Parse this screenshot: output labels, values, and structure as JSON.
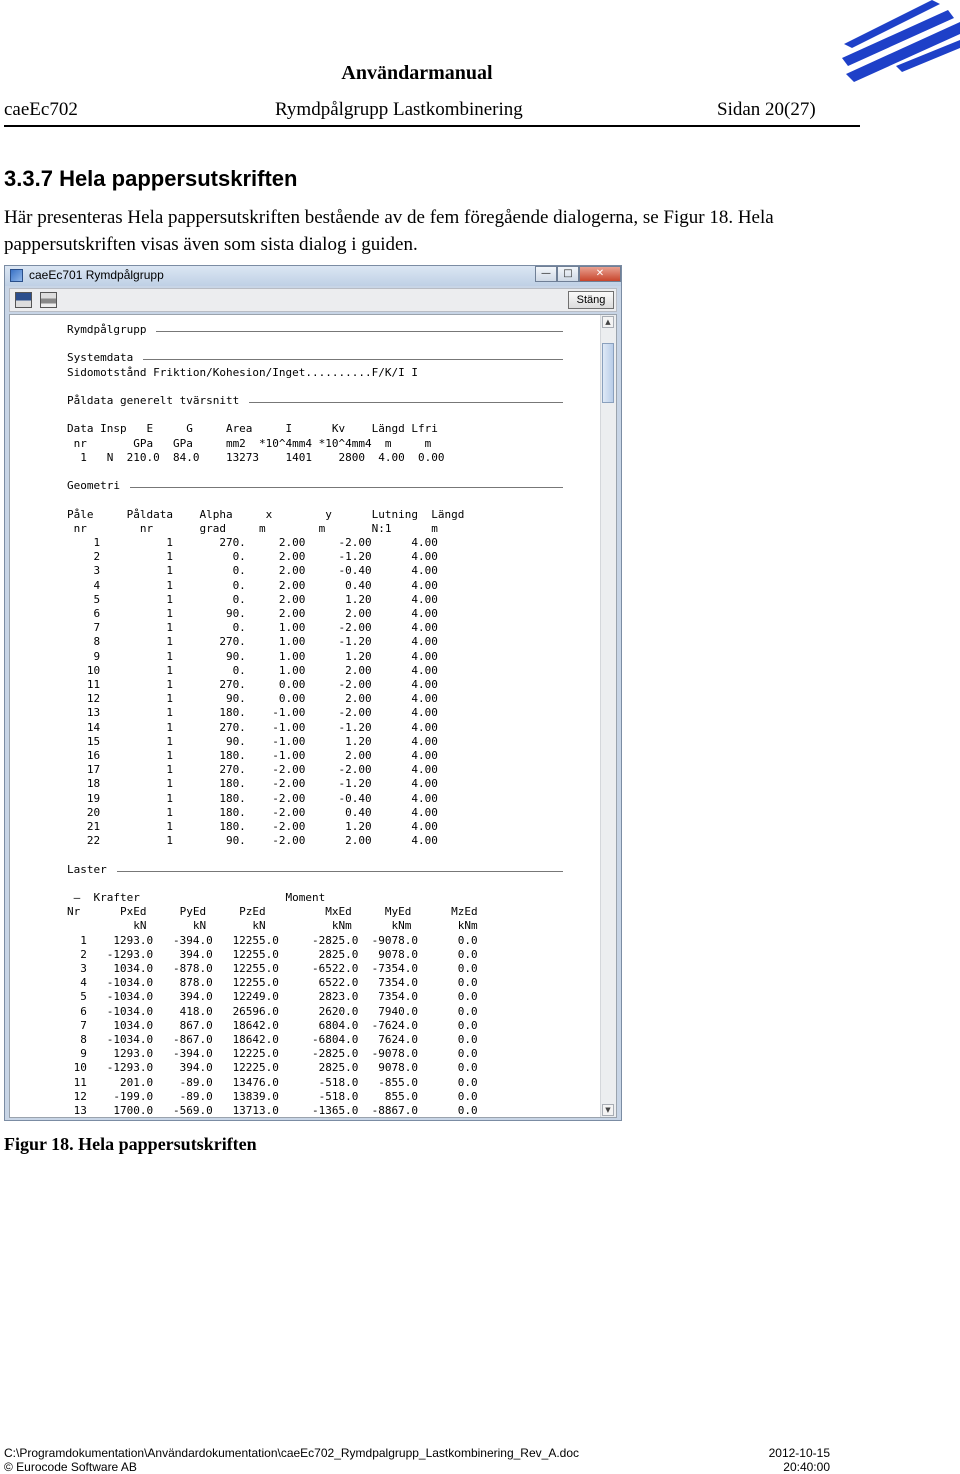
{
  "header": {
    "manual_title": "Användarmanual",
    "product": "caeEc702",
    "module": "Rymdpålgrupp Lastkombinering",
    "page": "Sidan 20(27)"
  },
  "section": {
    "number": "3.3.7",
    "title": "Hela pappersutskriften",
    "paragraph": "Här presenteras Hela pappersutskriften bestående av de fem föregående dialogerna, se Figur 18. Hela pappersutskriften visas även som sista dialog i guiden."
  },
  "window": {
    "title": "caeEc701 Rymdpålgrupp",
    "close_button": "Stäng",
    "report": {
      "heading": "Rymdpålgrupp",
      "systemdata_title": "Systemdata",
      "systemdata_line": "Sidomotstånd Friktion/Kohesion/Inget..........F/K/I I",
      "paldata_title": "Påldata generelt tvärsnitt",
      "paldata_header1": "Data Insp   E     G     Area     I      Kv    Längd Lfri",
      "paldata_header2": " nr       GPa   GPa     mm2  *10^4mm4 *10^4mm4  m     m",
      "paldata_row": "  1   N  210.0  84.0    13273    1401    2800  4.00  0.00",
      "geometri_title": "Geometri",
      "geometri_header1": "Påle     Påldata    Alpha     x        y      Lutning  Längd",
      "geometri_header2": " nr        nr       grad     m        m       N:1      m",
      "geometri_rows": [
        [
          "1",
          "1",
          "270.",
          "2.00",
          "-2.00",
          "4.00"
        ],
        [
          "2",
          "1",
          "0.",
          "2.00",
          "-1.20",
          "4.00"
        ],
        [
          "3",
          "1",
          "0.",
          "2.00",
          "-0.40",
          "4.00"
        ],
        [
          "4",
          "1",
          "0.",
          "2.00",
          "0.40",
          "4.00"
        ],
        [
          "5",
          "1",
          "0.",
          "2.00",
          "1.20",
          "4.00"
        ],
        [
          "6",
          "1",
          "90.",
          "2.00",
          "2.00",
          "4.00"
        ],
        [
          "7",
          "1",
          "0.",
          "1.00",
          "-2.00",
          "4.00"
        ],
        [
          "8",
          "1",
          "270.",
          "1.00",
          "-1.20",
          "4.00"
        ],
        [
          "9",
          "1",
          "90.",
          "1.00",
          "1.20",
          "4.00"
        ],
        [
          "10",
          "1",
          "0.",
          "1.00",
          "2.00",
          "4.00"
        ],
        [
          "11",
          "1",
          "270.",
          "0.00",
          "-2.00",
          "4.00"
        ],
        [
          "12",
          "1",
          "90.",
          "0.00",
          "2.00",
          "4.00"
        ],
        [
          "13",
          "1",
          "180.",
          "-1.00",
          "-2.00",
          "4.00"
        ],
        [
          "14",
          "1",
          "270.",
          "-1.00",
          "-1.20",
          "4.00"
        ],
        [
          "15",
          "1",
          "90.",
          "-1.00",
          "1.20",
          "4.00"
        ],
        [
          "16",
          "1",
          "180.",
          "-1.00",
          "2.00",
          "4.00"
        ],
        [
          "17",
          "1",
          "270.",
          "-2.00",
          "-2.00",
          "4.00"
        ],
        [
          "18",
          "1",
          "180.",
          "-2.00",
          "-1.20",
          "4.00"
        ],
        [
          "19",
          "1",
          "180.",
          "-2.00",
          "-0.40",
          "4.00"
        ],
        [
          "20",
          "1",
          "180.",
          "-2.00",
          "0.40",
          "4.00"
        ],
        [
          "21",
          "1",
          "180.",
          "-2.00",
          "1.20",
          "4.00"
        ],
        [
          "22",
          "1",
          "90.",
          "-2.00",
          "2.00",
          "4.00"
        ]
      ],
      "laster_title": "Laster",
      "laster_group": " —  Krafter                      Moment",
      "laster_header1": "Nr      PxEd     PyEd     PzEd         MxEd     MyEd      MzEd",
      "laster_header2": "          kN       kN       kN          kNm      kNm       kNm",
      "laster_rows": [
        [
          "1",
          "1293.0",
          "-394.0",
          "12255.0",
          "-2825.0",
          "-9078.0",
          "0.0"
        ],
        [
          "2",
          "-1293.0",
          "394.0",
          "12255.0",
          "2825.0",
          "9078.0",
          "0.0"
        ],
        [
          "3",
          "1034.0",
          "-878.0",
          "12255.0",
          "-6522.0",
          "-7354.0",
          "0.0"
        ],
        [
          "4",
          "-1034.0",
          "878.0",
          "12255.0",
          "6522.0",
          "7354.0",
          "0.0"
        ],
        [
          "5",
          "-1034.0",
          "394.0",
          "12249.0",
          "2823.0",
          "7354.0",
          "0.0"
        ],
        [
          "6",
          "-1034.0",
          "418.0",
          "26596.0",
          "2620.0",
          "7940.0",
          "0.0"
        ],
        [
          "7",
          "1034.0",
          "867.0",
          "18642.0",
          "6804.0",
          "-7624.0",
          "0.0"
        ],
        [
          "8",
          "-1034.0",
          "-867.0",
          "18642.0",
          "-6804.0",
          "7624.0",
          "0.0"
        ],
        [
          "9",
          "1293.0",
          "-394.0",
          "12225.0",
          "-2825.0",
          "-9078.0",
          "0.0"
        ],
        [
          "10",
          "-1293.0",
          "394.0",
          "12225.0",
          "2825.0",
          "9078.0",
          "0.0"
        ],
        [
          "11",
          "201.0",
          "-89.0",
          "13476.0",
          "-518.0",
          "-855.0",
          "0.0"
        ],
        [
          "12",
          "-199.0",
          "-89.0",
          "13839.0",
          "-518.0",
          "855.0",
          "0.0"
        ],
        [
          "13",
          "1700.0",
          "-569.0",
          "13713.0",
          "-1365.0",
          "-8867.0",
          "0.0"
        ]
      ]
    }
  },
  "caption": "Figur 18. Hela pappersutskriften",
  "footer": {
    "path": "C:\\Programdokumentation\\Användardokumentation\\caeEc702_Rymdpalgrupp_Lastkombinering_Rev_A.doc",
    "datetime": "2012-10-15 20:40:00",
    "copyright": "© Eurocode Software AB"
  },
  "colors": {
    "logo_blue": "#1e40c8",
    "window_frame": "#c8d5e6"
  }
}
